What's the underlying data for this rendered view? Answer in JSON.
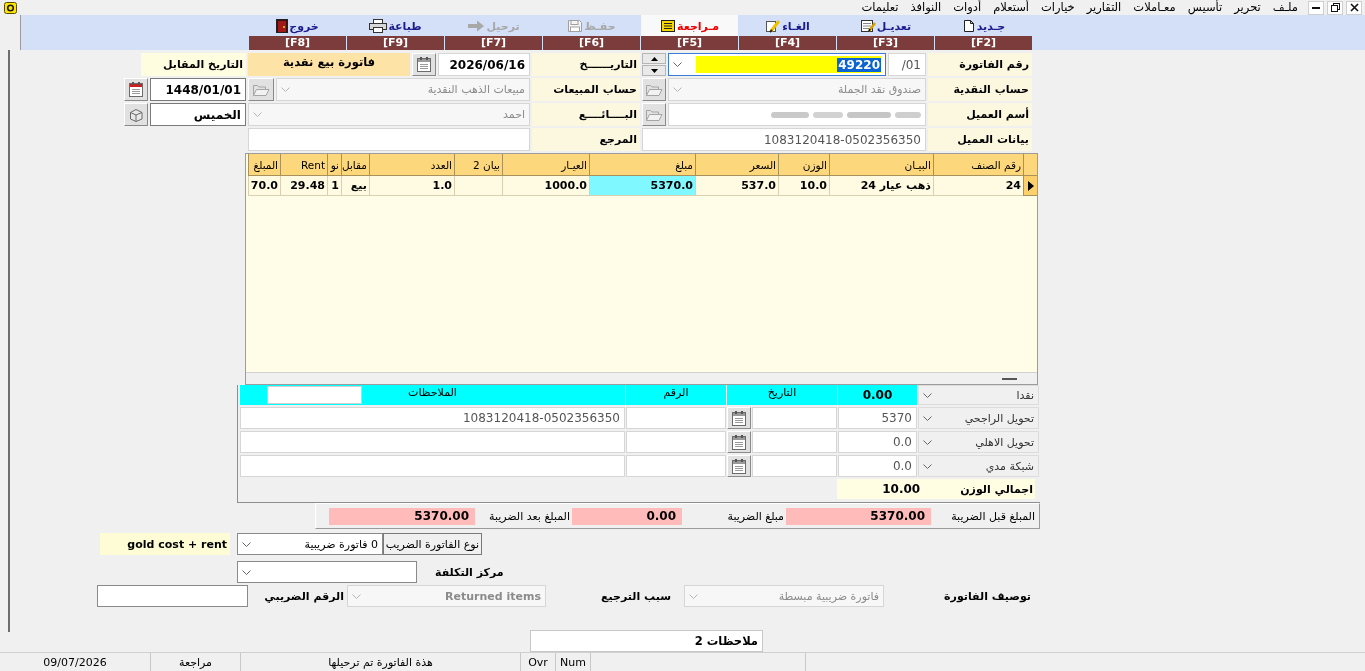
{
  "menu_bar": {
    "items": [
      "ملـف",
      "تحرير",
      "تأسيس",
      "معـاملات",
      "التقارير",
      "خيارات",
      "أستعلام",
      "أدوات",
      "النوافذ",
      "تعليمات"
    ]
  },
  "toolbar": {
    "buttons": [
      {
        "kind": "new",
        "label": "جـديد",
        "key": "[F2]",
        "selected": false,
        "disabled": false
      },
      {
        "kind": "edit",
        "label": "تعديـل",
        "key": "[F3]",
        "selected": false,
        "disabled": false
      },
      {
        "kind": "cancel",
        "label": "الغـاء",
        "key": "[F4]",
        "selected": false,
        "disabled": false
      },
      {
        "kind": "review",
        "label": "مـراجعة",
        "key": "[F5]",
        "selected": true,
        "disabled": false
      },
      {
        "kind": "save",
        "label": "حفـظ",
        "key": "[F6]",
        "selected": false,
        "disabled": true
      },
      {
        "kind": "post",
        "label": "ترحيل",
        "key": "[F7]",
        "selected": false,
        "disabled": true
      },
      {
        "kind": "print",
        "label": "طباعة",
        "key": "[F9]",
        "selected": false,
        "disabled": false
      },
      {
        "kind": "exit",
        "label": "خروج",
        "key": "[F8]",
        "selected": false,
        "disabled": false
      }
    ]
  },
  "header_form": {
    "invoice_number": {
      "label": "رقم الفاتورة",
      "prefix": "/01",
      "value": "49220",
      "focused": true
    },
    "date": {
      "label": "التاريــــــخ",
      "value": "2026/06/16"
    },
    "invoice_type": "فاتورة بيع نقدية",
    "counter_date": {
      "label": "التاريخ المقابل",
      "value": "1448/01/01"
    },
    "cash_account": {
      "label": "حساب النقدية",
      "value": "صندوق نقد الجملة",
      "disabled": true
    },
    "sales_account": {
      "label": "حساب المبيعات",
      "value": "مبيعات الذهب النقدية",
      "disabled": true
    },
    "day": "الخميس",
    "customer_name": {
      "label": "أسم العميل"
    },
    "seller": {
      "label": "البــــائــــع",
      "value": "احمد",
      "disabled": true
    },
    "customer_info": {
      "label": "بيانات العميل",
      "value": "1083120418-0502356350"
    },
    "reference": {
      "label": "المرجع"
    }
  },
  "items_table": {
    "columns": [
      "رقم الصنف",
      "البيـان",
      "الوزن",
      "السعر",
      "مبلغ",
      "العيـار",
      "بيان 2",
      "العدد",
      "مقابل",
      "نو",
      "Rent",
      "المبلغ"
    ],
    "rows": [
      {
        "selected": true,
        "cells": [
          {
            "text": "24",
            "selected": false
          },
          {
            "text": "ذهب عيار 24",
            "selected": false
          },
          {
            "text": "10.0",
            "selected": false
          },
          {
            "text": "537.0",
            "selected": false
          },
          {
            "text": "5370.0",
            "selected": true
          },
          {
            "text": "1000.0",
            "selected": false
          },
          {
            "selected": false
          },
          {
            "text": "1.0",
            "selected": false
          },
          {
            "text": "بيع",
            "selected": false
          },
          {
            "text": "1",
            "selected": false
          },
          {
            "text": "29.48",
            "selected": false
          },
          {
            "text": "70.0",
            "selected": false
          }
        ]
      }
    ]
  },
  "payments": {
    "cash": {
      "label": "نقدا",
      "amount": "0.00"
    },
    "columns": [
      "التاريخ",
      "الرقم",
      "الملاحظات"
    ],
    "rows": [
      {
        "method": "تحويل الراجحي",
        "amount": "5370",
        "notes": "1083120418-0502356350"
      },
      {
        "method": "تحويل الاهلي",
        "amount": "0.0"
      },
      {
        "method": "شبكة مدي",
        "amount": "0.0"
      }
    ],
    "total_weight": {
      "label": "اجمالي الوزن",
      "value": "10.00"
    }
  },
  "totals": [
    {
      "label": "المبلغ قبل الضريبة",
      "value": "5370.00"
    },
    {
      "label": "مبلغ الضريبة",
      "value": "0.00"
    },
    {
      "label": "المبلغ بعد الضريبة",
      "value": "5370.00"
    }
  ],
  "footer_form": {
    "pricing_note": "gold cost + rent",
    "tax_invoice_type": {
      "label": "نوع الفاتورة الضريب",
      "value": "0 فاتورة ضريبية"
    },
    "cost_center": {
      "label": "مركز التكلفة"
    },
    "invoice_description": {
      "label": "توصيف الفاتورة",
      "value": "فاتورة ضريبية مبسطة",
      "disabled": true
    },
    "return_reason": {
      "label": "سبب الترجيع",
      "value": "Returned items",
      "disabled": true
    },
    "tax_number": {
      "label": "الرقم الضريبي"
    },
    "notes_2": {
      "value": "ملاحظات 2"
    }
  },
  "status_bar": {
    "panels": [
      "Num",
      "Ovr",
      "هذة الفاتورة تم ترحيلها",
      "مراجعة",
      "09/07/2026"
    ]
  }
}
